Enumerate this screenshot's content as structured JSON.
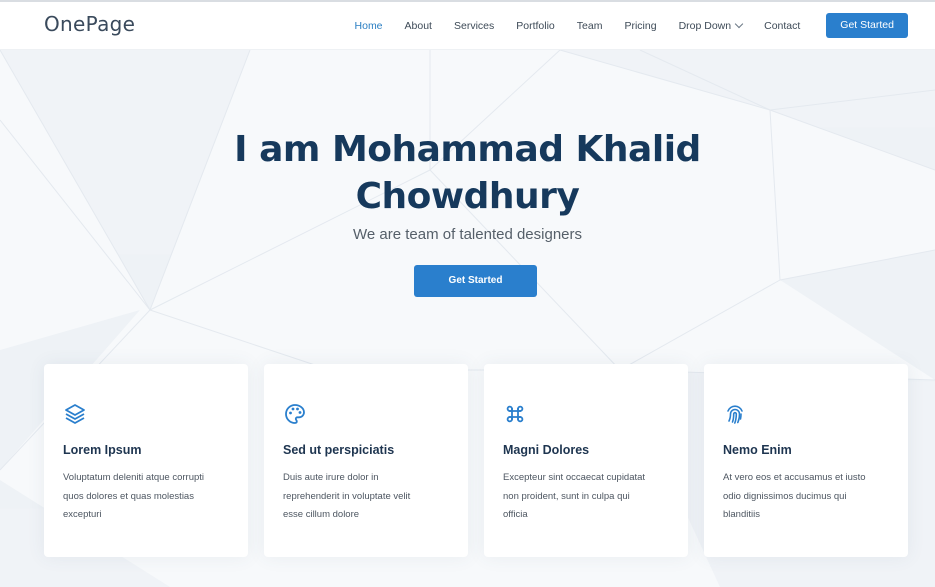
{
  "header": {
    "logo": "OnePage",
    "nav": [
      {
        "label": "Home",
        "active": true
      },
      {
        "label": "About"
      },
      {
        "label": "Services"
      },
      {
        "label": "Portfolio"
      },
      {
        "label": "Team"
      },
      {
        "label": "Pricing"
      },
      {
        "label": "Drop Down",
        "has_dropdown": true
      },
      {
        "label": "Contact"
      }
    ],
    "cta_label": "Get Started"
  },
  "hero": {
    "title_line1": "I am Mohammad Khalid",
    "title_line2": "Chowdhury",
    "subtitle": "We are team of talented designers",
    "button_label": "Get Started"
  },
  "cards": [
    {
      "icon": "layers-icon",
      "title": "Lorem Ipsum",
      "desc_lines": [
        "Voluptatum deleniti atque corrupti",
        "quos dolores et quas molestias",
        "excepturi"
      ]
    },
    {
      "icon": "palette-icon",
      "title": "Sed ut perspiciatis",
      "desc_lines": [
        "Duis aute irure dolor in",
        "reprehenderit in voluptate velit",
        "esse cillum dolore"
      ]
    },
    {
      "icon": "command-icon",
      "title": "Magni Dolores",
      "desc_lines": [
        "Excepteur sint occaecat cupidatat",
        "non proident, sunt in culpa qui",
        "officia"
      ]
    },
    {
      "icon": "fingerprint-icon",
      "title": "Nemo Enim",
      "desc_lines": [
        "At vero eos et accusamus et iusto",
        "odio dignissimos ducimus qui",
        "blanditiis"
      ]
    }
  ],
  "colors": {
    "accent": "#2a7fcd",
    "heading": "#16395c",
    "hero_bg": "#f7f9fb"
  }
}
